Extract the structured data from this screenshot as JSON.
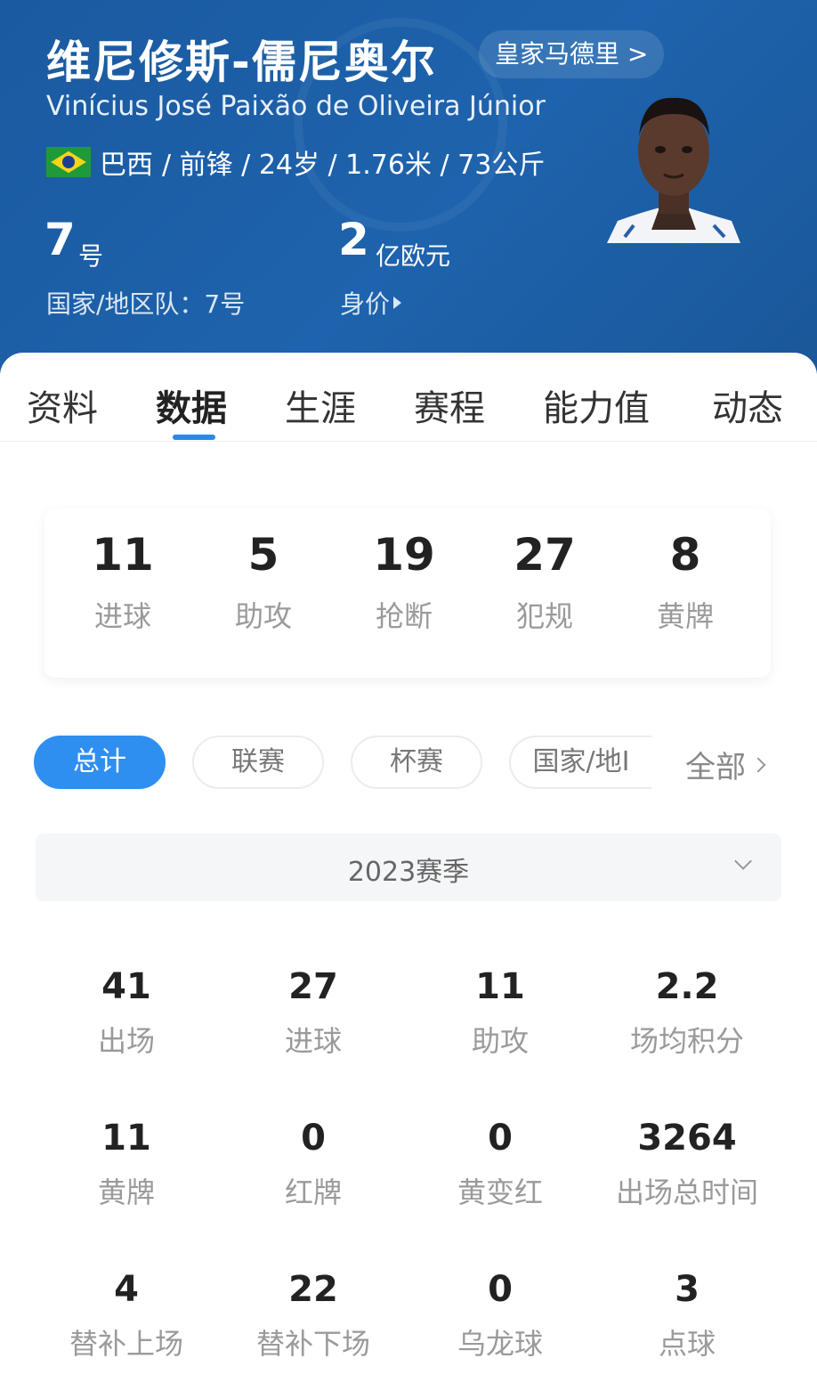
{
  "header": {
    "name_cn": "维尼修斯-儒尼奥尔",
    "club": "皇家马德里 >",
    "name_full": "Vinícius José Paixão de Oliveira Júnior",
    "nationality": "巴西",
    "info": "/ 前锋 / 24岁 / 1.76米 / 73公斤",
    "number": "7",
    "number_unit": "号",
    "national_team": "国家/地区队：7号",
    "value": "2",
    "value_unit": "亿欧元",
    "value_label": "身价"
  },
  "tabs": [
    {
      "label": "资料"
    },
    {
      "label": "数据"
    },
    {
      "label": "生涯"
    },
    {
      "label": "赛程"
    },
    {
      "label": "能力值"
    },
    {
      "label": "动态"
    }
  ],
  "summary": [
    {
      "value": "11",
      "label": "进球"
    },
    {
      "value": "5",
      "label": "助攻"
    },
    {
      "value": "19",
      "label": "抢断"
    },
    {
      "value": "27",
      "label": "犯规"
    },
    {
      "value": "8",
      "label": "黄牌"
    }
  ],
  "filters": [
    {
      "label": "总计"
    },
    {
      "label": "联赛"
    },
    {
      "label": "杯赛"
    },
    {
      "label": "国家/地I"
    }
  ],
  "all_label": "全部",
  "season": "2023赛季",
  "stats": [
    {
      "value": "41",
      "label": "出场"
    },
    {
      "value": "27",
      "label": "进球"
    },
    {
      "value": "11",
      "label": "助攻"
    },
    {
      "value": "2.2",
      "label": "场均积分"
    },
    {
      "value": "11",
      "label": "黄牌"
    },
    {
      "value": "0",
      "label": "红牌"
    },
    {
      "value": "0",
      "label": "黄变红"
    },
    {
      "value": "3264",
      "label": "出场总时间"
    },
    {
      "value": "4",
      "label": "替补上场"
    },
    {
      "value": "22",
      "label": "替补下场"
    },
    {
      "value": "0",
      "label": "乌龙球"
    },
    {
      "value": "3",
      "label": "点球"
    }
  ],
  "colors": {
    "header_blue": "#1e63ad",
    "accent_blue": "#2e8ff0",
    "brazil_green": "#1f9a3a",
    "brazil_yellow": "#f7d416"
  }
}
